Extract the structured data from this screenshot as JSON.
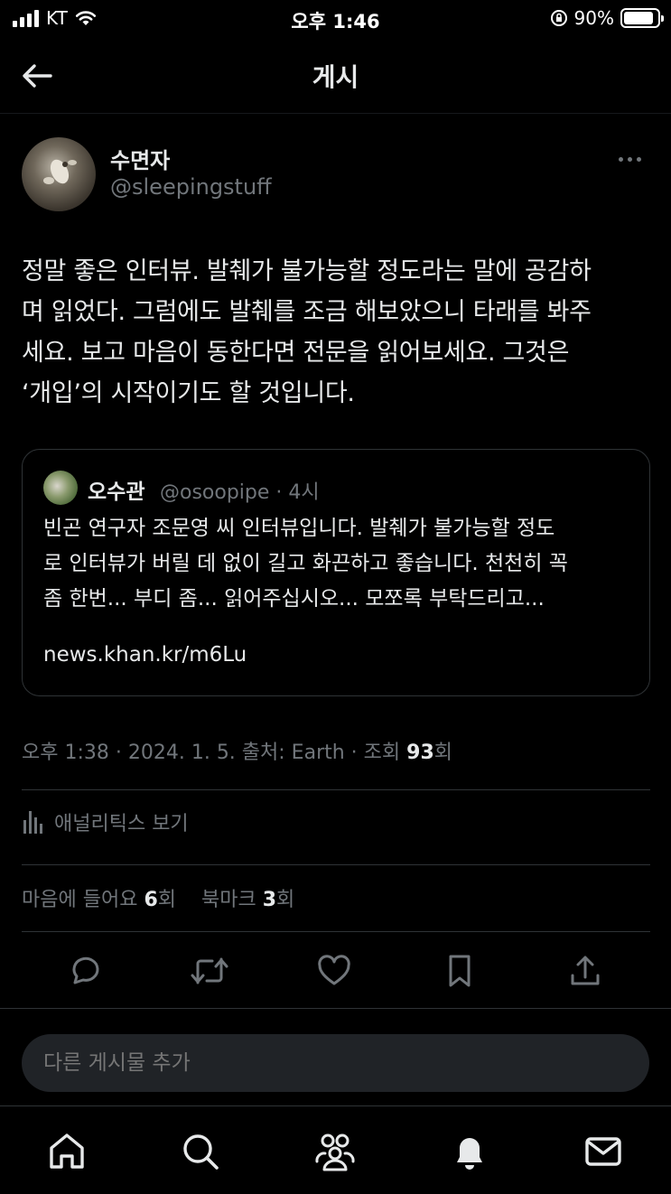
{
  "status_bar": {
    "carrier": "KT",
    "time": "오후 1:46",
    "battery": "90%",
    "battery_level": 0.9
  },
  "header": {
    "title": "게시",
    "back_icon": "arrow-left-icon"
  },
  "post": {
    "author_name": "수면자",
    "author_handle": "@sleepingstuff",
    "text_lines": [
      "정말 좋은 인터뷰. 발췌가 불가능할 정도라는 말에 공감하",
      "며 읽었다. 그럼에도 발췌를 조금 해보았으니 타래를 봐주",
      "세요. 보고 마음이 동한다면 전문을 읽어보세요. 그것은",
      "‘개입’의 시작이기도 할 것입니다."
    ],
    "timestamp_prefix": "오후 1:38 · 2024. 1. 5. 출처: Earth · 조회 ",
    "views": "93",
    "views_suffix": "회"
  },
  "quote": {
    "name": "오수관",
    "meta": "@osoopipe · 4시",
    "text_lines": [
      "빈곤 연구자 조문영 씨 인터뷰입니다. 발췌가 불가능할 정도",
      "로 인터뷰가 버릴 데 없이 길고 화끈하고 좋습니다. 천천히 꼭",
      "좀 한번... 부디 좀... 읽어주십시오... 모쪼록 부탁드리고..."
    ],
    "link": "news.khan.kr/m6Lu"
  },
  "analytics": {
    "label": "애널리틱스 보기",
    "icon": "bar-chart-icon"
  },
  "stats": {
    "likes_label": "마음에 들어요 ",
    "likes": "6",
    "likes_suffix": "회",
    "bookmarks_label": "북마크 ",
    "bookmarks": "3",
    "bookmarks_suffix": "회"
  },
  "actions": [
    "reply-icon",
    "repost-icon",
    "like-icon",
    "bookmark-icon",
    "share-icon"
  ],
  "composer": {
    "placeholder": "다른 게시물 추가"
  },
  "bottom_nav": [
    "home-icon",
    "search-icon",
    "communities-icon",
    "notifications-icon",
    "messages-icon"
  ],
  "colors": {
    "background": "#000000",
    "text": "#e7e9ea",
    "secondary": "#71767b",
    "border": "#2f3336",
    "composer_bg": "#202327"
  }
}
